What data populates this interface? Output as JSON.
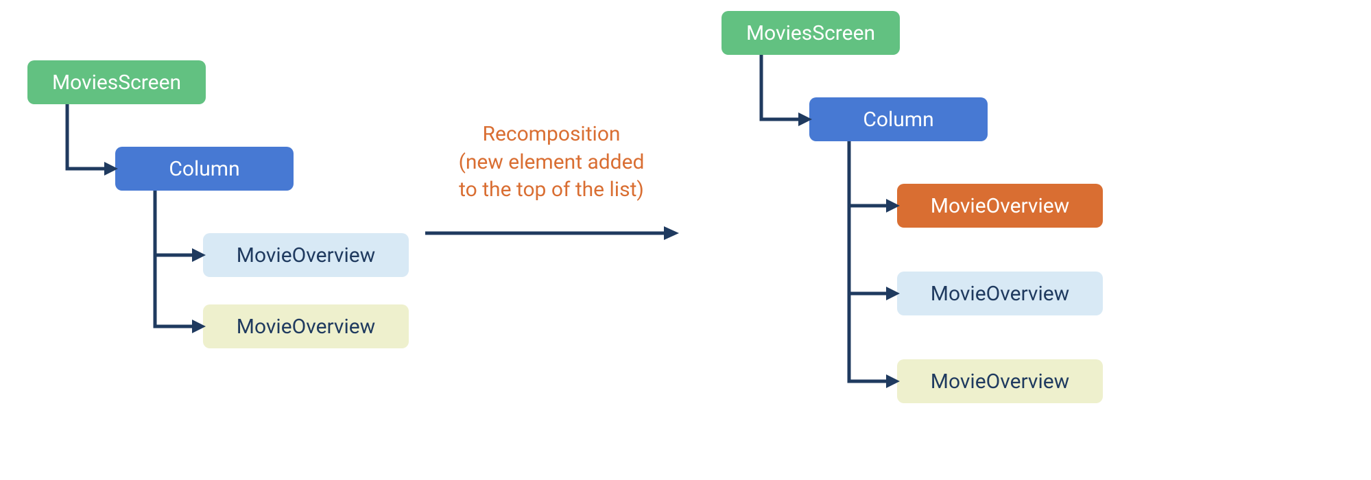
{
  "colors": {
    "green": "#62c181",
    "blue": "#4779d3",
    "lightblue": "#d8e9f5",
    "lightyellow": "#eef0cd",
    "orange": "#d96e32",
    "arrow": "#1f3a5f",
    "textDark": "#1f3a5f"
  },
  "left_tree": {
    "root": "MoviesScreen",
    "column": "Column",
    "children": [
      {
        "label": "MovieOverview",
        "style": "lightblue"
      },
      {
        "label": "MovieOverview",
        "style": "lightyellow"
      }
    ]
  },
  "right_tree": {
    "root": "MoviesScreen",
    "column": "Column",
    "children": [
      {
        "label": "MovieOverview",
        "style": "orange"
      },
      {
        "label": "MovieOverview",
        "style": "lightblue"
      },
      {
        "label": "MovieOverview",
        "style": "lightyellow"
      }
    ]
  },
  "transition": {
    "line1": "Recomposition",
    "line2": "(new element added",
    "line3": "to the top of the list)"
  }
}
